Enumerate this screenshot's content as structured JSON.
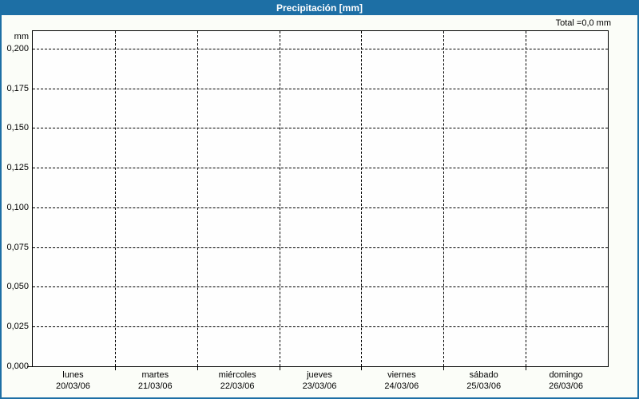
{
  "window": {
    "title": "Precipitación [mm]"
  },
  "colors": {
    "accent": "#1d6fa5",
    "background": "#fbfdf8",
    "plot_background": "#fefefe",
    "grid": "#000000",
    "title_text": "#ffffff",
    "text": "#000000"
  },
  "chart": {
    "total_label": "Total =0,0 mm",
    "unit_label": "mm"
  },
  "chart_data": {
    "type": "bar",
    "title": "Precipitación [mm]",
    "categories": [
      "20/03/06",
      "21/03/06",
      "22/03/06",
      "23/03/06",
      "24/03/06",
      "25/03/06",
      "26/03/06"
    ],
    "category_day_names": [
      "lunes",
      "martes",
      "miércoles",
      "jueves",
      "viernes",
      "sábado",
      "domingo"
    ],
    "values": [
      0,
      0,
      0,
      0,
      0,
      0,
      0
    ],
    "total_annotation": "Total =0,0 mm",
    "xlabel": "",
    "ylabel": "mm",
    "ylim": [
      0,
      0.211
    ],
    "yticks": [
      0.0,
      0.025,
      0.05,
      0.075,
      0.1,
      0.125,
      0.15,
      0.175,
      0.2
    ],
    "ytick_labels": [
      "0,000",
      "0,025",
      "0,050",
      "0,075",
      "0,100",
      "0,125",
      "0,150",
      "0,175",
      "0,200"
    ],
    "grid": "dashed-both-axes",
    "legend": "none"
  }
}
